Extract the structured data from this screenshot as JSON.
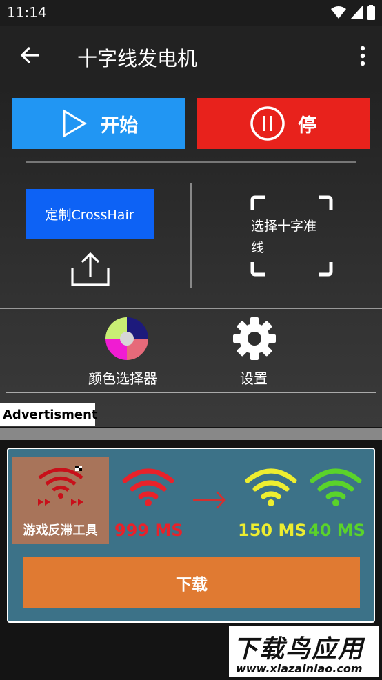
{
  "status_bar": {
    "time": "11:14",
    "icons": [
      "wifi-icon",
      "cellular-icon",
      "battery-icon"
    ]
  },
  "app_bar": {
    "title": "十字线发电机",
    "back_icon": "arrow-left-icon",
    "menu_icon": "more-vert-icon"
  },
  "controls": {
    "start_label": "开始",
    "stop_label": "停"
  },
  "tools": {
    "custom_label": "定制CrossHair",
    "upload_icon": "upload-icon",
    "select_label": "选择十字准线"
  },
  "bottom_nav": {
    "color_picker_label": "颜色选择器",
    "settings_label": "设置"
  },
  "ad": {
    "tag": "Advertisment",
    "thumb_label": "游戏反滞工具",
    "ms_before": "999 MS",
    "ms_after_1": "150 MS",
    "ms_after_2": "40 MS",
    "download_label": "下载"
  },
  "watermark": {
    "main": "下载鸟应用",
    "sub": "www.xiazainiao.com"
  },
  "colors": {
    "start": "#2196f3",
    "stop": "#e8221c",
    "custom": "#0d62f5",
    "ad_card": "#3c7288",
    "download": "#e07a32",
    "red_ms": "#e8222a",
    "yellow_ms": "#eded30",
    "green_ms": "#5ad32a"
  }
}
